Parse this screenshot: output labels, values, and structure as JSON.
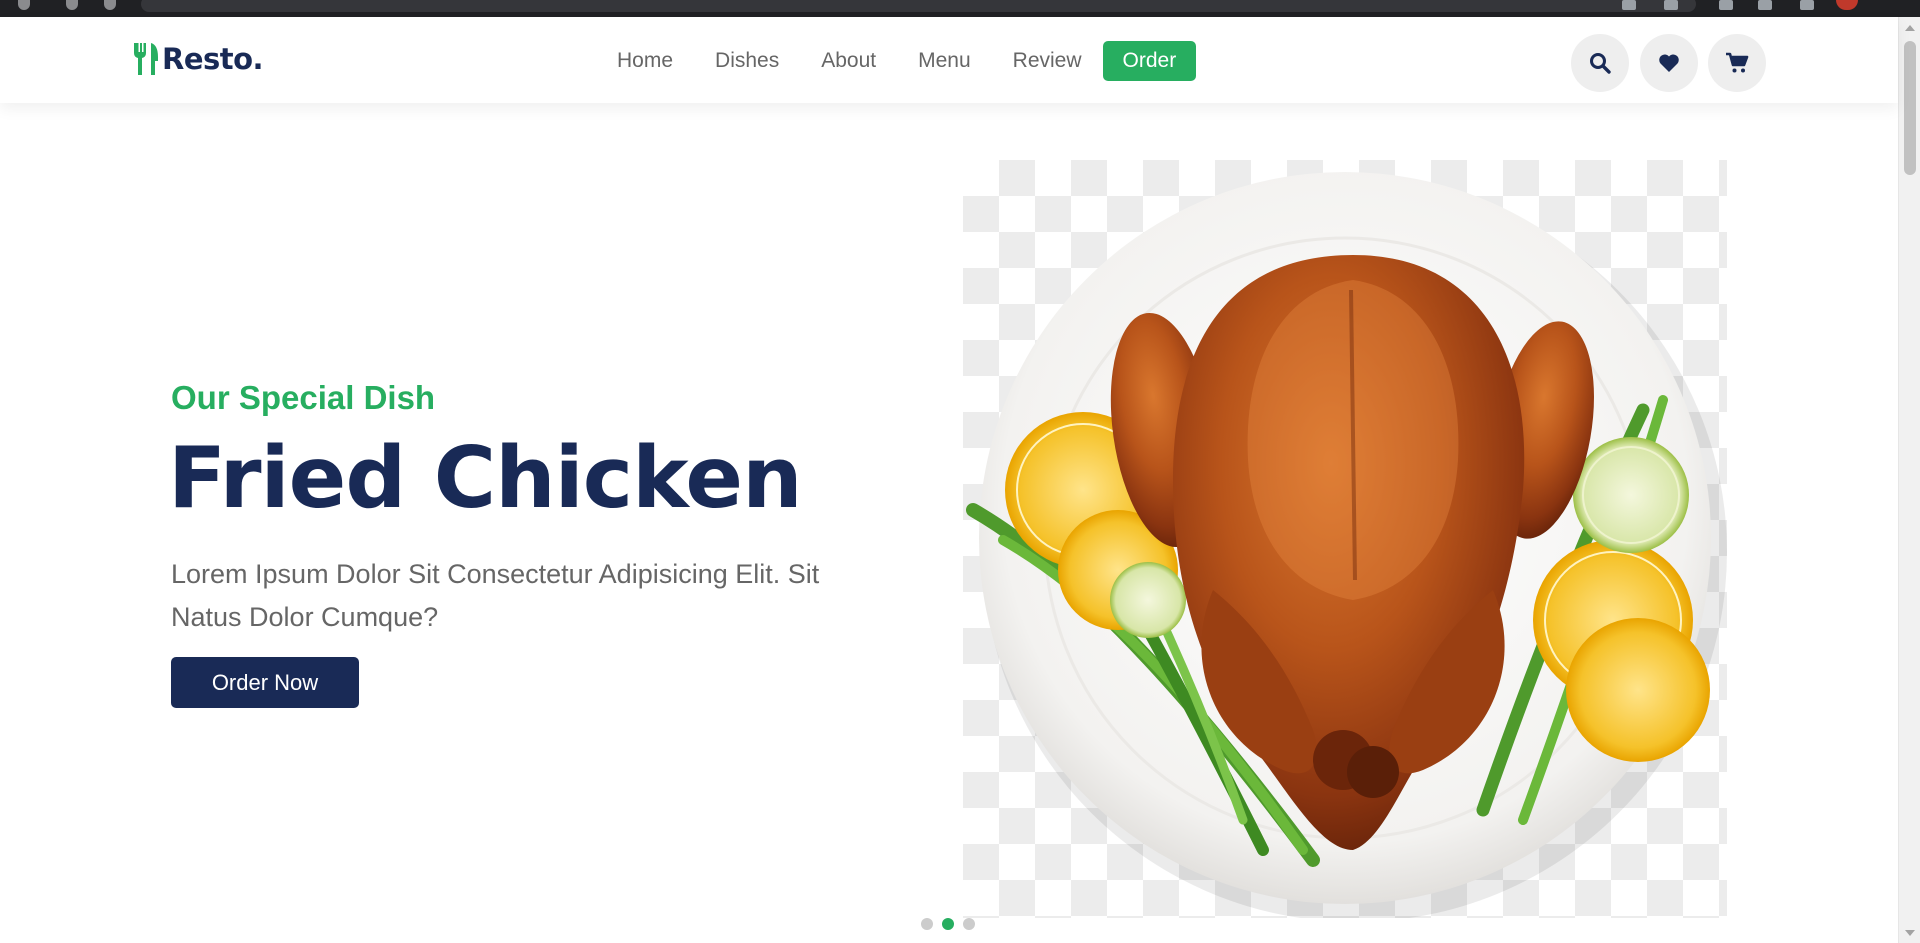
{
  "brand": {
    "name": "Resto.",
    "accent_color": "#27ae60",
    "primary_color": "#192a56",
    "logo_icon": "utensils-icon"
  },
  "nav": {
    "items": [
      {
        "label": "Home",
        "active": false
      },
      {
        "label": "Dishes",
        "active": false
      },
      {
        "label": "About",
        "active": false
      },
      {
        "label": "Menu",
        "active": false
      },
      {
        "label": "Review",
        "active": false
      },
      {
        "label": "Order",
        "active": true
      }
    ]
  },
  "header_icons": [
    "search-icon",
    "heart-icon",
    "cart-icon"
  ],
  "hero": {
    "subtitle": "Our Special Dish",
    "title": "Fried Chicken",
    "description": "Lorem Ipsum Dolor Sit Consectetur Adipisicing Elit. Sit Natus Dolor Cumque?",
    "button_label": "Order Now",
    "slides": {
      "count": 3,
      "active_index": 1
    }
  }
}
